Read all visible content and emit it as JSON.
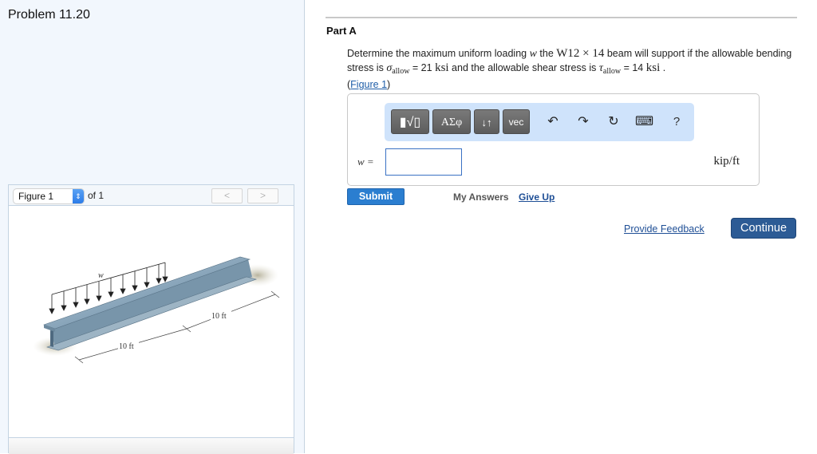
{
  "problem": {
    "title": "Problem 11.20"
  },
  "figure_panel": {
    "selected_figure": "Figure 1",
    "of_label": "of 1",
    "prev_icon": "chevron-left-icon",
    "next_icon": "chevron-right-icon",
    "prev_glyph": "<",
    "next_glyph": ">",
    "load_label": "w",
    "dimension_labels": [
      "10 ft",
      "10 ft"
    ]
  },
  "part": {
    "title": "Part A",
    "question": {
      "t1": "Determine the maximum uniform loading ",
      "var_w": "w",
      "t2": " the ",
      "beam": "W12 × 14",
      "t3": " beam will support if the allowable bending stress is ",
      "sigma": "σ",
      "sigma_sub": "allow",
      "sigma_val": " = 21 ",
      "ksi1": "ksi",
      "t4": " and the allowable shear stress is ",
      "tau": "τ",
      "tau_sub": "allow",
      "tau_val": " = 14 ",
      "ksi2": "ksi",
      "t5": " .",
      "fig_open": "(",
      "fig_link": "Figure 1",
      "fig_close": ")"
    }
  },
  "toolbar": {
    "templates_label": "▮√▯",
    "greek_label": "ΑΣφ",
    "arrows_label": "↓↑",
    "vec_label": "vec",
    "undo_glyph": "↶",
    "redo_glyph": "↷",
    "reset_glyph": "↻",
    "keyboard_glyph": "⌨",
    "help_label": "?"
  },
  "answer": {
    "variable_label": "w =",
    "value": "",
    "unit": "kip/ft"
  },
  "actions": {
    "submit_label": "Submit",
    "my_answers_label": "My Answers",
    "give_up_label": "Give Up",
    "provide_feedback_label": "Provide Feedback",
    "continue_label": "Continue"
  },
  "colors": {
    "submit_blue": "#2b7ed0",
    "continue_navy": "#2c5b95",
    "toolbar_bg": "#cfe3fb",
    "link_blue": "#1f4f96"
  }
}
